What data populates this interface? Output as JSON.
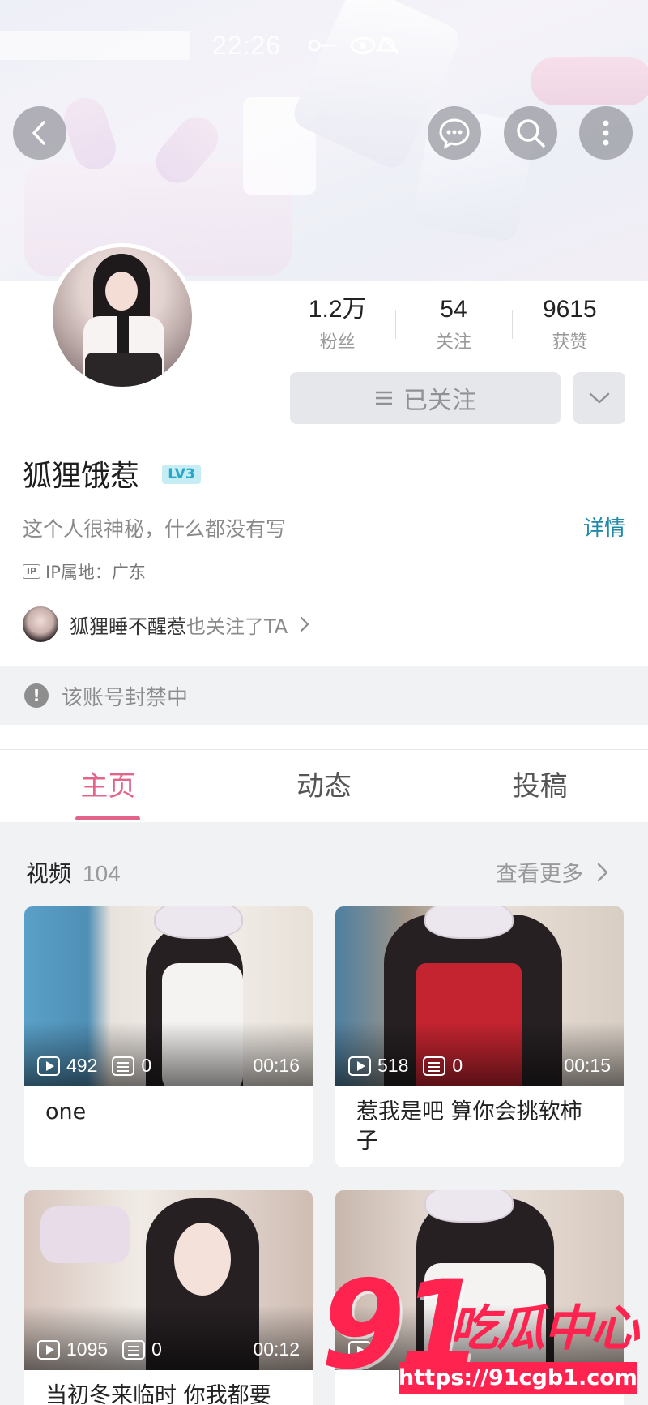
{
  "status_bar": {
    "time": "22:26"
  },
  "header": {
    "back_icon": "chevron-left-icon",
    "message_icon": "chat-bubble-icon",
    "search_icon": "search-icon",
    "more_icon": "more-vertical-icon"
  },
  "profile": {
    "username": "狐狸饿惹",
    "level": "LV3",
    "bio": "这个人很神秘，什么都没有写",
    "detail_link": "详情",
    "ip_label": "IP属地：广东",
    "stats": [
      {
        "value": "1.2万",
        "label": "粉丝"
      },
      {
        "value": "54",
        "label": "关注"
      },
      {
        "value": "9615",
        "label": "获赞"
      }
    ],
    "follow_button": "已关注",
    "mutual": {
      "name": "狐狸睡不醒惹",
      "suffix": "也关注了TA"
    },
    "banned_notice": "该账号封禁中"
  },
  "tabs": [
    {
      "label": "主页",
      "active": true
    },
    {
      "label": "动态",
      "active": false
    },
    {
      "label": "投稿",
      "active": false
    }
  ],
  "videos_section": {
    "title": "视频",
    "count": "104",
    "see_more": "查看更多",
    "items": [
      {
        "plays": "492",
        "danmaku": "0",
        "duration": "00:16",
        "title": "one"
      },
      {
        "plays": "518",
        "danmaku": "0",
        "duration": "00:15",
        "title": "惹我是吧 算你会挑软柿子"
      },
      {
        "plays": "1095",
        "danmaku": "0",
        "duration": "00:12",
        "title": "当初冬来临时 你我都要"
      },
      {
        "plays": "",
        "danmaku": "",
        "duration": "",
        "title": ""
      }
    ]
  },
  "watermark": {
    "number": "91",
    "text": "吃瓜中心",
    "url": "https://91cgb1.com"
  },
  "colors": {
    "accent_pink": "#e3648a",
    "link_blue": "#1f8aa8",
    "watermark_red": "#ff2350"
  }
}
